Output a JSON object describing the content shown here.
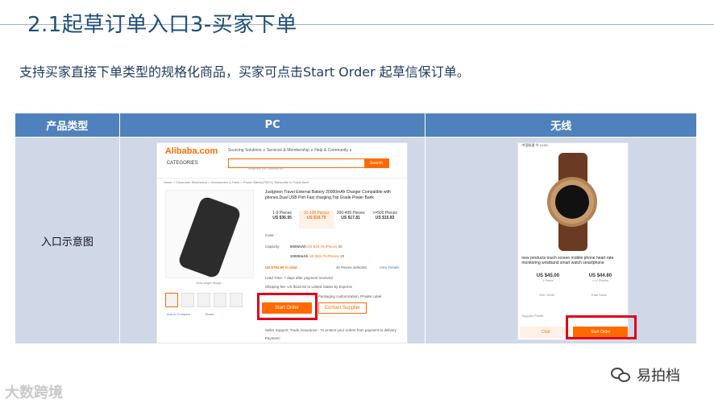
{
  "slide": {
    "title": "2.1起草订单入口3-买家下单",
    "subtitle": "支持买家直接下单类型的规格化商品，买家可点击Start Order 起草信保订单。"
  },
  "table": {
    "headers": [
      "产品类型",
      "PC",
      "无线"
    ],
    "row_label": "入口示意图"
  },
  "pc_screenshot": {
    "logo": "Alibaba.com",
    "categories": "CATEGORIES",
    "menu": "Sourcing Solutions ∨   Services & Membership ∨   Help & Community ∨",
    "search_placeholder": "What are you looking for...",
    "search_button": "Search",
    "breadcrumb": "Home > Consumer Electronics > Accessories & Parts > Power Banks(73671) Subscribe to Trade Alert",
    "product_title": "Justgreen Travel External Battery 20000mAh Charger Compatible with phones,Dual USB Port Fast charging,Top Grade Power Bank",
    "price_tiers": [
      {
        "qty": "1-9 Pieces",
        "price": "US $36.95"
      },
      {
        "qty": "10-199 Pieces",
        "price": "US $19.79"
      },
      {
        "qty": "200-499 Pieces",
        "price": "US $17.81"
      },
      {
        "qty": ">=500 Pieces",
        "price": "US $15.83"
      }
    ],
    "color_label": "Color:",
    "capacity_label": "Capacity:",
    "capacity_options": [
      {
        "name": "5000mAh",
        "price": "US $19.79 /Pieces",
        "qty": "20"
      },
      {
        "name": "10000mAh",
        "price": "US $19.79 /Pieces",
        "qty": "20"
      }
    ],
    "total": "US $791.60 in total",
    "selected": "40 Pieces selected",
    "view_details": "View Details",
    "lead_time": "Lead Time:   7 days after payment received",
    "shipping": "Shipping fee:   US $126.50 to United States by Express",
    "customization": "Packaging customization, Private Label",
    "view_larger": "View larger image",
    "add_compare": "Add to Compare",
    "share": "Share",
    "start_order": "Start Order",
    "contact_supplier": "Contact Supplier",
    "seller_support": "Seller Support:   Trade Assurance - To protect your orders from payment to delivery",
    "payment": "Payment:"
  },
  "mobile_screenshot": {
    "status_bar": "中国联通 令  10:59",
    "product_title": "new products touch screen mobile phone heart rate monitoring wristband smart watch smartphone",
    "prices": [
      {
        "price": "US $45.00",
        "qty": "1 Piece"
      },
      {
        "price": "US $44.80",
        "qty": ">=2 Pieces"
      }
    ],
    "min_order": "Min. Order",
    "total_stock": "Total Stock",
    "supplier_profile": "Supplier Profile",
    "chat": "Chat",
    "start_order": "Start Order"
  },
  "watermarks": {
    "left": "大数跨境",
    "right": "易拍档"
  },
  "colors": {
    "title": "#1F4E79",
    "header_bg": "#4F81BD",
    "cell_bg": "#D0D8E8",
    "alibaba_orange": "#ff6a00",
    "highlight_red": "#e0001b"
  }
}
